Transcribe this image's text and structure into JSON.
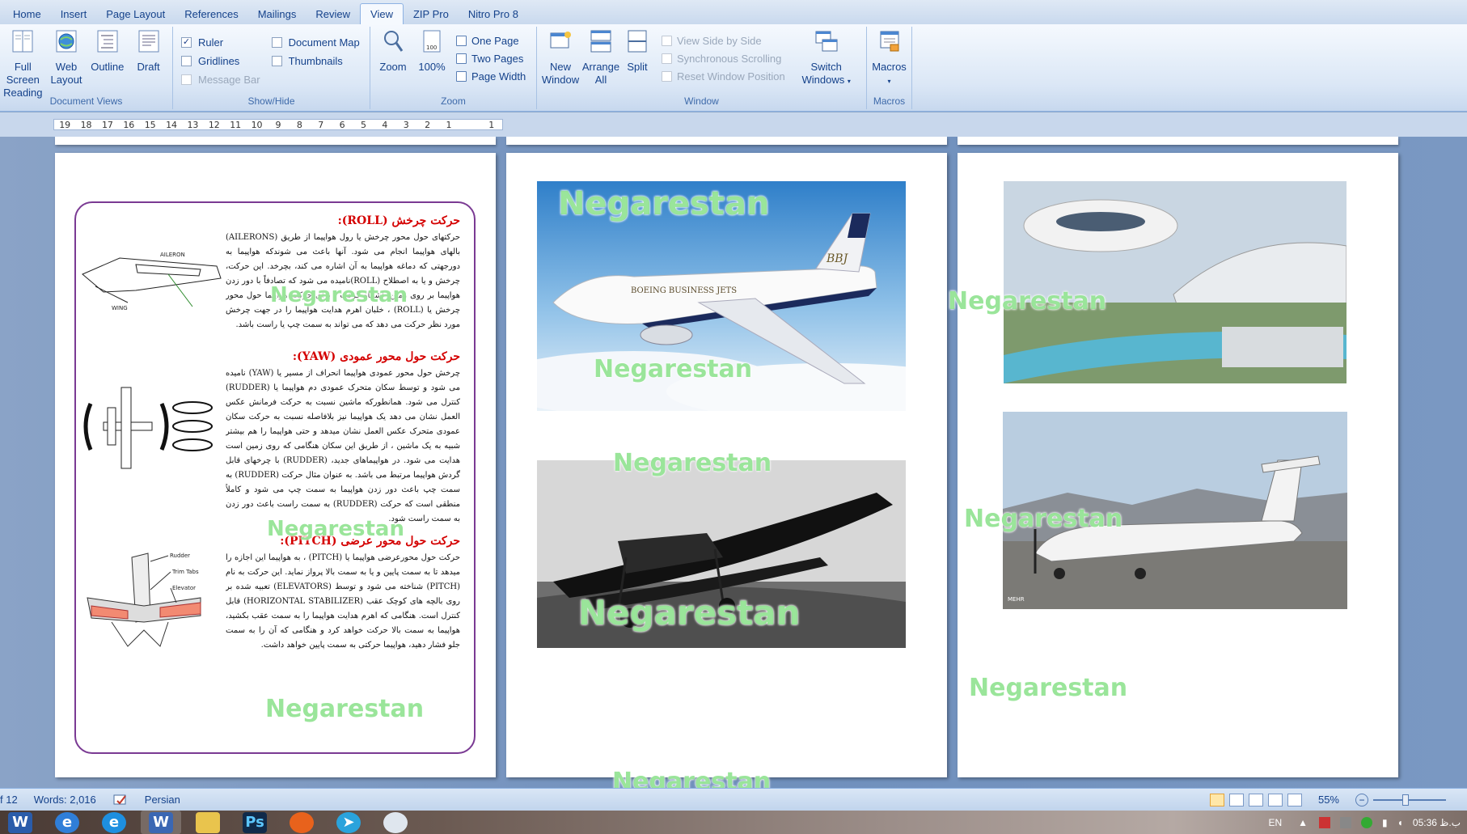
{
  "tabs": [
    "Home",
    "Insert",
    "Page Layout",
    "References",
    "Mailings",
    "Review",
    "View",
    "ZIP Pro",
    "Nitro Pro 8"
  ],
  "active_tab": "View",
  "groups": {
    "document_views": {
      "label": "Document Views",
      "buttons": [
        "Full Screen Reading",
        "Web Layout",
        "Outline",
        "Draft"
      ]
    },
    "show_hide": {
      "label": "Show/Hide",
      "ruler": "Ruler",
      "gridlines": "Gridlines",
      "message_bar": "Message Bar",
      "document_map": "Document Map",
      "thumbnails": "Thumbnails"
    },
    "zoom": {
      "label": "Zoom",
      "zoom": "Zoom",
      "percent": "100%",
      "one_page": "One Page",
      "two_pages": "Two Pages",
      "page_width": "Page Width"
    },
    "window": {
      "label": "Window",
      "new_window": "New Window",
      "arrange_all": "Arrange All",
      "split": "Split",
      "side_by_side": "View Side by Side",
      "sync_scroll": "Synchronous Scrolling",
      "reset_position": "Reset Window Position",
      "switch_windows": "Switch Windows"
    },
    "macros": {
      "label": "Macros",
      "macros": "Macros"
    }
  },
  "ruler_numbers": [
    "19",
    "18",
    "17",
    "16",
    "15",
    "14",
    "13",
    "12",
    "11",
    "10",
    "9",
    "8",
    "7",
    "6",
    "5",
    "4",
    "3",
    "2",
    "1",
    "",
    "1"
  ],
  "document": {
    "roll_heading": "حرکت چرخش (ROLL):",
    "roll_text": "حرکتهای حول محور چرخش یا رول هواپیما از طریق (AILERONS) بالهای هواپیما انجام می شود. آنها باعث می شوندکه هواپیما به دورجهتی که دماغه هواپیما به آن اشاره می کند، بچرخد. این حرکت، چرخش و یا به اصطلاح (ROLL)نامیده می شود که تصادفاً با دور زدن هواپیما بر روی زمین، اشتباه گرفت . برای حرکت هواپیما حول محور چرخش یا (ROLL) ، خلبان اهرم هدایت هواپیما را در جهت چرخش مورد نظر حرکت می دهد که می تواند به سمت چپ یا راست باشد.",
    "yaw_heading": "حرکت حول محور عمودی (YAW):",
    "yaw_text": "چرخش حول محور عمودی هواپیما انحراف از مسیر یا (YAW) نامیده می شود و توسط سکان متحرک عمودی دم هواپیما یا (RUDDER) کنترل می شود. همانطورکه ماشین نسبت به حرکت فرمانش عکس العمل نشان می دهد یک هواپیما نیز بلافاصله نسبت به حرکت سکان عمودی متحرک عکس العمل نشان میدهد و حتی هواپیما را هم بیشتر شبیه به یک ماشین ، از طریق این سکان هنگامی که روی زمین است هدایت می شود. در هواپیماهای جدید، (RUDDER) با چرخهای قابل گردش هواپیما مرتبط می باشد. به عنوان مثال حرکت (RUDDER) به سمت چپ باعث دور زدن هواپیما به سمت چپ می شود و کاملاً منطقی است که حرکت (RUDDER) به سمت راست باعث دور زدن به سمت راست شود.",
    "pitch_heading": "حرکت حول محور عرضی (PITCH):",
    "pitch_text": "حرکت حول محورعرضی هواپیما یا (PITCH) ، به هواپیما این اجازه را میدهد تا به سمت پایین و یا به سمت بالا پرواز نماید. این حرکت به نام (PITCH) شناخته می شود و توسط (ELEVATORS) تعبیه شده بر روی بالچه های کوچک عقب (HORIZONTAL STABILIZER) قابل کنترل است. هنگامی که اهرم هدایت هواپیما را به سمت عقب بکشید، هواپیما به سمت بالا حرکت خواهد کرد و هنگامی که آن را به سمت جلو فشار دهید، هواپیما حرکتی به سمت پایین خواهد داشت.",
    "wing_labels": [
      "AILERON",
      "WING"
    ],
    "tail_labels": [
      "Rudder",
      "Trim Tabs",
      "Elevator"
    ],
    "photo_texts": [
      "BOEING BUSINESS JETS",
      "BBJ",
      "MEHR"
    ]
  },
  "watermark": "Negarestan",
  "status": {
    "page": "f 12",
    "words": "Words: 2,016",
    "language": "Persian",
    "zoom": "55%"
  },
  "taskbar": {
    "lang": "EN",
    "clock": "05:36 ب.ظ"
  },
  "colors": {
    "heading_red": "#d40000",
    "frame_purple": "#7a3a93",
    "ribbon_text": "#15428b"
  }
}
